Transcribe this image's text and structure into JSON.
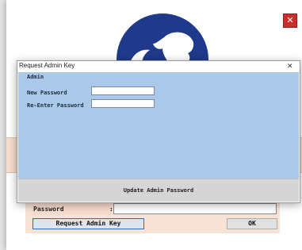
{
  "background_window": {
    "close_glyph": "✕"
  },
  "login": {
    "password_label": "Password",
    "password_colon": ":",
    "password_value": "",
    "request_button": "Request Admin Key",
    "ok_button": "OK"
  },
  "dialog": {
    "title": "Request Admin Key",
    "close_glyph": "✕",
    "section": "Admin",
    "fields": [
      {
        "label": "New Password",
        "value": ""
      },
      {
        "label": "Re-Enter Password",
        "value": ""
      }
    ],
    "update_button": "Update Admin Password"
  },
  "colors": {
    "dialog_body": "#a9c8ea",
    "peach": "#f4dccd",
    "logo_blue": "#1f3a8a",
    "close_red": "#c9302c"
  }
}
